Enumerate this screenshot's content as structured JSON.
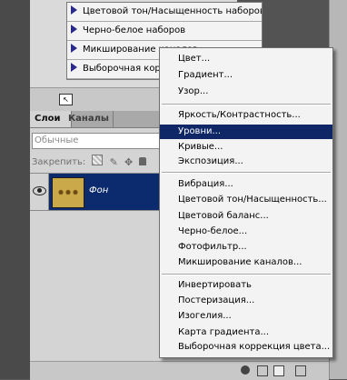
{
  "adjustments_list": {
    "items": [
      "Цветовой тон/Насыщенность наборов",
      "Черно-белое наборов",
      "Микширование каналов",
      "Выборочная коррекция"
    ]
  },
  "layers_panel": {
    "tabs": [
      "Слои",
      "Каналы"
    ],
    "blend_mode": "Обычные",
    "lock_label": "Закрепить:",
    "layer_name": "Фон"
  },
  "menu": {
    "groups": [
      [
        "Цвет...",
        "Градиент...",
        "Узор..."
      ],
      [
        "Яркость/Контрастность...",
        "Уровни...",
        "Кривые...",
        "Экспозиция..."
      ],
      [
        "Вибрация...",
        "Цветовой тон/Насыщенность...",
        "Цветовой баланс...",
        "Черно-белое...",
        "Фотофильтр...",
        "Микширование каналов..."
      ],
      [
        "Инвертировать",
        "Постеризация...",
        "Изогелия...",
        "Карта градиента...",
        "Выборочная коррекция цвета..."
      ]
    ],
    "highlighted": "Уровни..."
  },
  "colors": {
    "highlight": "#0f2767",
    "panel": "#d4d4d4",
    "menu_bg": "#f3f3f3"
  }
}
